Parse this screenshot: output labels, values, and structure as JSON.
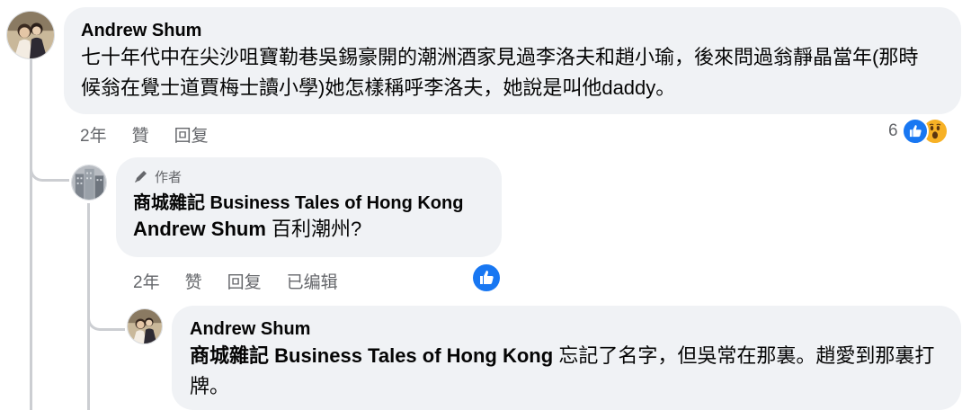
{
  "comments": [
    {
      "author": "Andrew Shum",
      "text": "七十年代中在尖沙咀寶勒巷吳錫豪開的潮洲酒家見過李洛夫和趙小瑜，後來問過翁靜晶當年(那時候翁在覺士道賈梅士讀小學)她怎樣稱呼李洛夫，她說是叫他daddy。",
      "time": "2年",
      "like": "贊",
      "reply": "回复",
      "reaction_count": "6",
      "reactions": [
        "like-icon",
        "wow-icon"
      ]
    },
    {
      "badge_label": "作者",
      "badge_icon": "pencil-icon",
      "author": "商城雜記 Business Tales of Hong Kong",
      "mention": "Andrew Shum",
      "text": "百利潮州?",
      "time": "2年",
      "like": "赞",
      "reply": "回复",
      "edited": "已编辑",
      "reactions": [
        "like-icon"
      ]
    },
    {
      "author": "Andrew Shum",
      "mention": "商城雜記 Business Tales of Hong Kong",
      "text": "忘記了名字，但吳常在那裏。趙愛到那裏打牌。"
    }
  ],
  "colors": {
    "bubble": "#f0f2f5",
    "meta_text": "#65676b",
    "like_blue": "#1877f2",
    "thread_line": "#ccced2"
  }
}
